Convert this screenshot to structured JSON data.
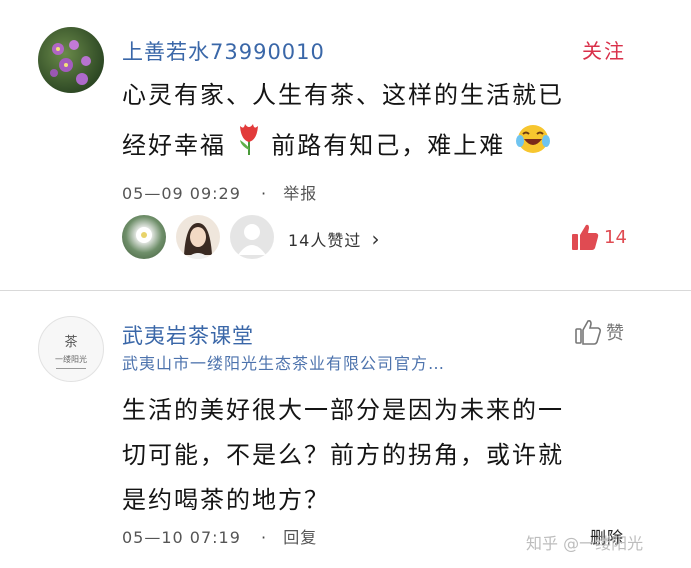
{
  "comment1": {
    "username": "上善若水73990010",
    "follow_label": "关注",
    "line1": "心灵有家、人生有茶、这样的生活就已",
    "line2_a": "经好幸福",
    "line2_b": "前路有知己，难上难",
    "time": "05—09 09:29",
    "separator": "·",
    "report_label": "举报",
    "likers_text": "14人赞过",
    "likers_chevron": "›",
    "like_count": "14"
  },
  "comment2": {
    "username": "武夷岩茶课堂",
    "subtitle": "武夷山市一缕阳光生态茶业有限公司官方…",
    "like_label": "赞",
    "line1": "生活的美好很大一部分是因为未来的一",
    "line2": "切可能，不是么？前方的拐角，或许就",
    "line3": "是约喝茶的地方？",
    "time": "05—10 07:19",
    "separator": "·",
    "reply_label": "回复",
    "delete_label": "删除"
  },
  "logo": {
    "char": "茶",
    "text": "一缕阳光"
  },
  "watermark": "知乎 @一缕阳光",
  "colors": {
    "username": "#3a67a8",
    "follow": "#d9304a",
    "like_active": "#e04b52",
    "divider": "#d9d9d9"
  },
  "icons": [
    "thumbs-up-icon",
    "thumbs-up-outline-icon",
    "tulip-icon",
    "laughing-emoji-icon",
    "chevron-right-icon"
  ]
}
